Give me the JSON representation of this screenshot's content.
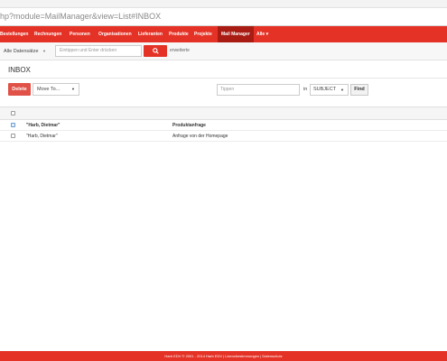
{
  "browser": {
    "url": "hp?module=MailManager&view=List#INBOX"
  },
  "nav": {
    "items": [
      {
        "label": "Bestellungen"
      },
      {
        "label": "Rechnungen"
      },
      {
        "label": "Personen"
      },
      {
        "label": "Organisationen"
      },
      {
        "label": "Lieferanten"
      },
      {
        "label": "Produkte"
      },
      {
        "label": "Projekte"
      },
      {
        "label": "Mail Manager"
      },
      {
        "label": "Alle"
      }
    ],
    "active_index": 7,
    "colors": {
      "bar": "#e53226",
      "active": "#a81c14"
    }
  },
  "search": {
    "datasets_label": "Alle Datensätze",
    "input_placeholder": "Eintippen und Enter drücken",
    "button_icon": "search-icon",
    "extended_label": "erweiterte"
  },
  "mail": {
    "folder_title": "INBOX",
    "delete_label": "Delete",
    "move_label": "Move To...",
    "filter_placeholder": "Tippen",
    "in_label": "in",
    "field_selected": "SUBJECT",
    "find_label": "Find",
    "rows": [
      {
        "from": "\"Harb, Dietmar\"",
        "subject": "Produktanfrage",
        "unread": true,
        "selected": true
      },
      {
        "from": "\"Harb, Dietmar\"",
        "subject": "Anfrage von der Homepage",
        "unread": false,
        "selected": false
      }
    ]
  },
  "footer": {
    "text": "Harb EDV © 2001 - 2014  Harb EDV | Lizenzbestimmungen | Datenschutz"
  }
}
